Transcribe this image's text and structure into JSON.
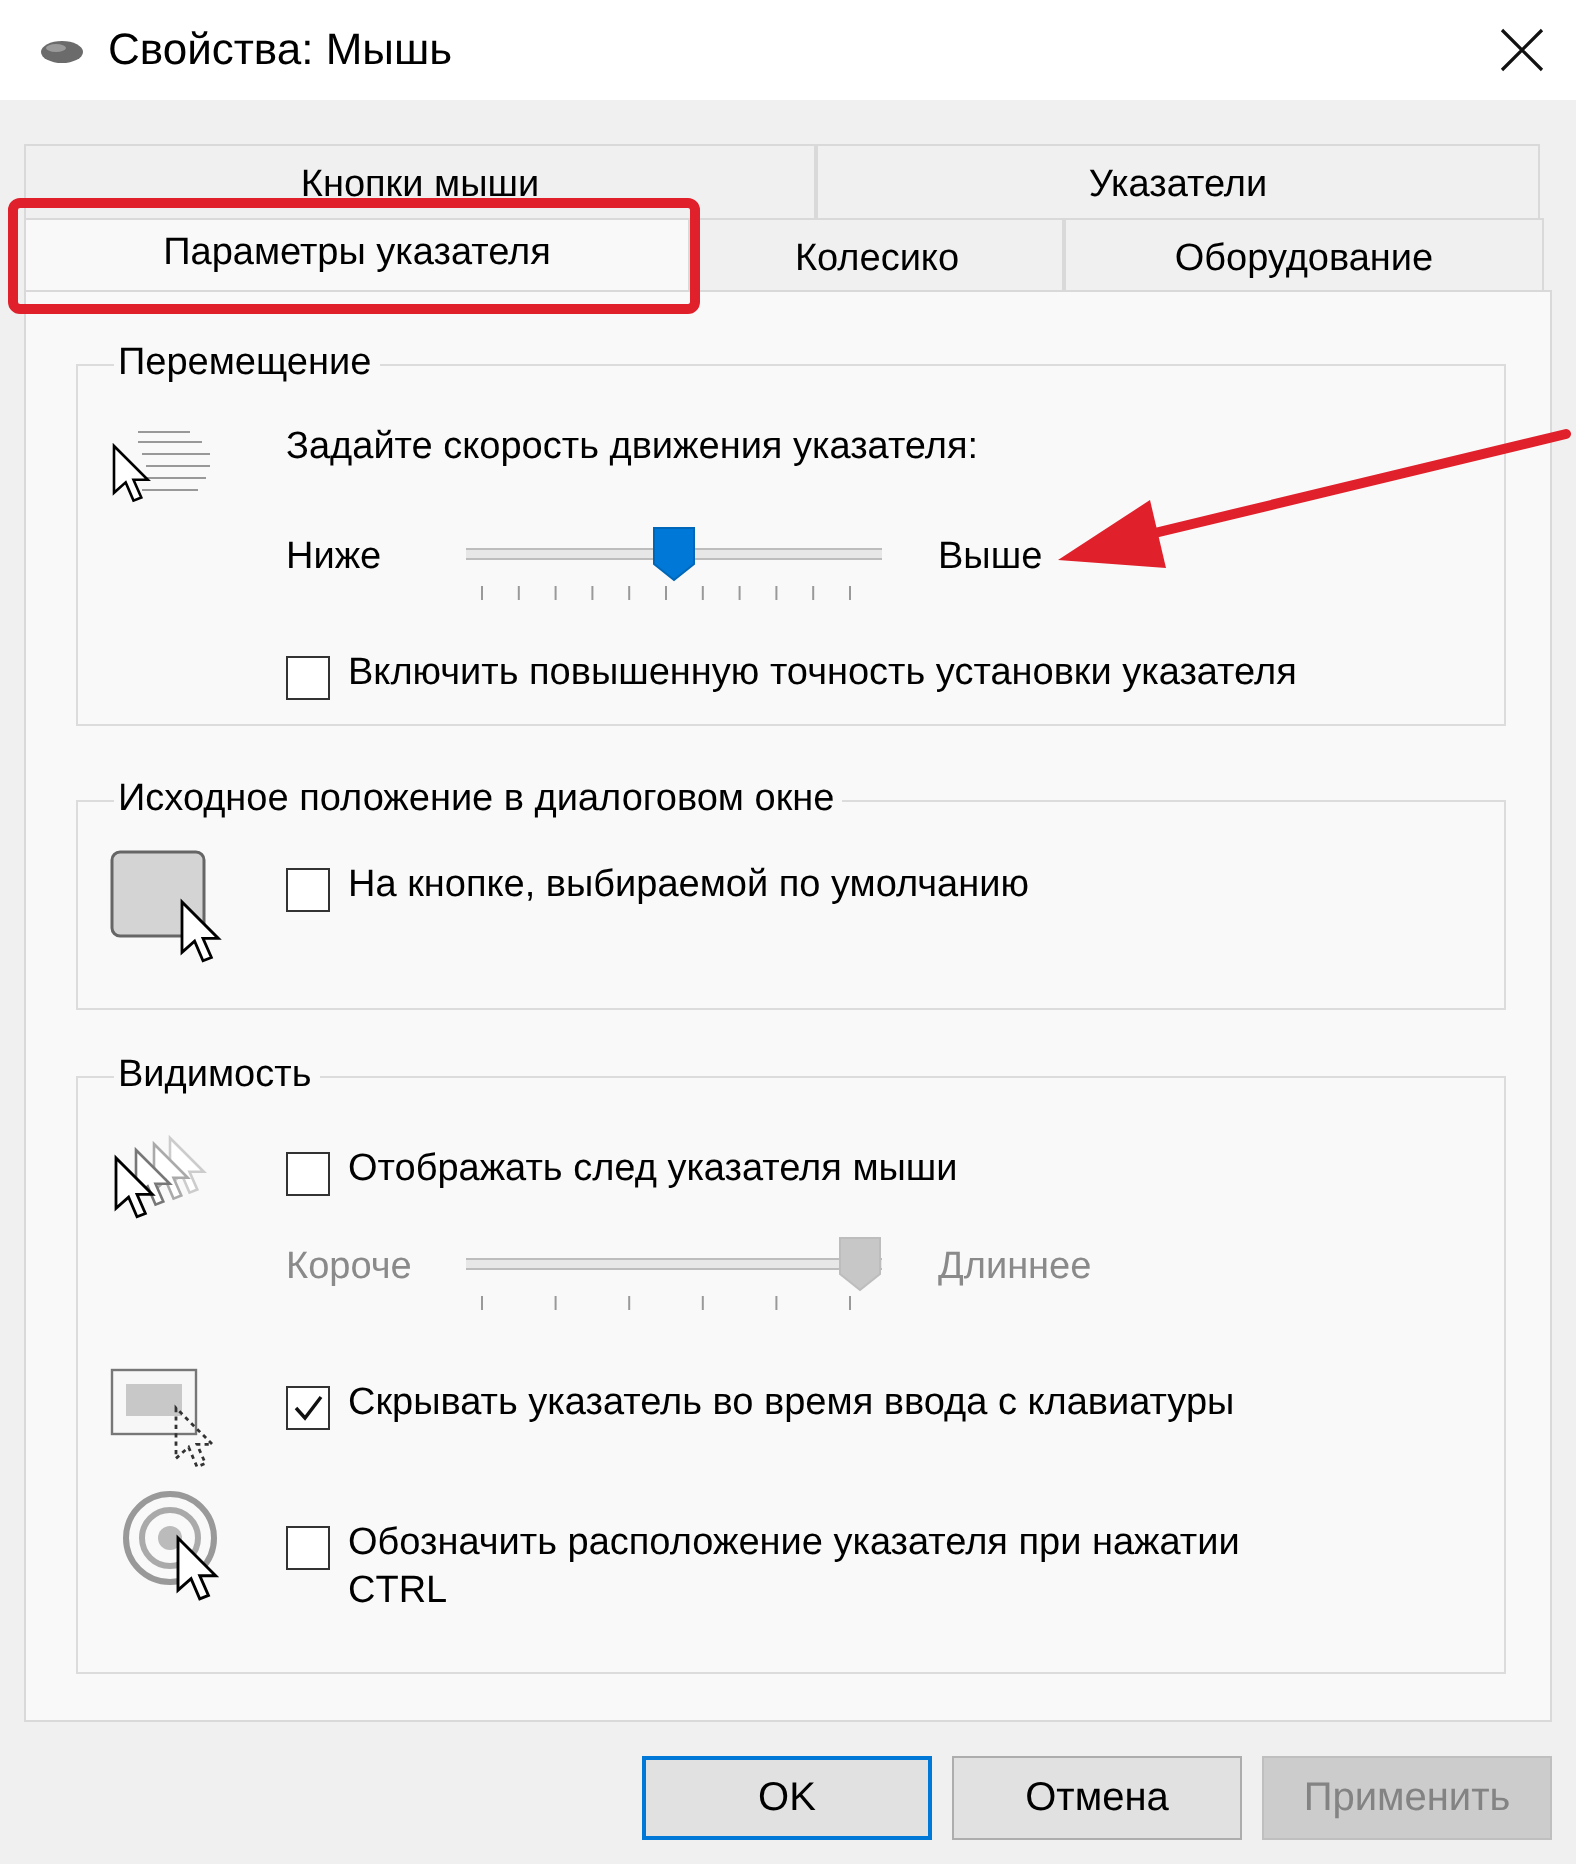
{
  "window": {
    "title": "Свойства: Мышь"
  },
  "tab_rows": [
    {
      "tabs": [
        {
          "label": "Кнопки мыши",
          "selected": false
        },
        {
          "label": "Указатели",
          "selected": false
        }
      ]
    },
    {
      "tabs": [
        {
          "label": "Параметры указателя",
          "selected": true
        },
        {
          "label": "Колесико",
          "selected": false
        },
        {
          "label": "Оборудование",
          "selected": false
        }
      ]
    }
  ],
  "groups": [
    {
      "title": "Перемещение",
      "sections": [
        {
          "items": [
            {
              "kind": "text",
              "text": "Задайте скорость движения указателя:"
            },
            {
              "kind": "slider",
              "low": "Ниже",
              "high": "Выше",
              "level": 0.5,
              "disabled": false
            },
            {
              "kind": "checkbox",
              "label": "Включить повышенную точность установки указателя",
              "checked": false
            }
          ]
        }
      ]
    },
    {
      "title": "Исходное положение в диалоговом окне",
      "sections": [
        {
          "items": [
            {
              "kind": "checkbox",
              "label": "На кнопке, выбираемой по умолчанию",
              "checked": false
            }
          ]
        }
      ]
    },
    {
      "title": "Видимость",
      "sections": [
        {
          "items": [
            {
              "kind": "checkbox",
              "label": "Отображать след указателя мыши",
              "checked": false
            },
            {
              "kind": "slider",
              "low": "Короче",
              "high": "Длиннее",
              "level": 1,
              "disabled": true
            }
          ]
        },
        {
          "items": [
            {
              "kind": "checkbox",
              "label": "Скрывать указатель во время ввода с клавиатуры",
              "checked": true
            }
          ]
        },
        {
          "items": [
            {
              "kind": "checkbox",
              "label": "Обозначить расположение указателя при нажатии CTRL",
              "checked": false
            }
          ]
        }
      ]
    }
  ],
  "buttons": [
    {
      "label": "OK",
      "focused": true,
      "disabled": false
    },
    {
      "label": "Отмена",
      "focused": false,
      "disabled": false
    },
    {
      "label": "Применить",
      "focused": false,
      "disabled": true
    }
  ]
}
